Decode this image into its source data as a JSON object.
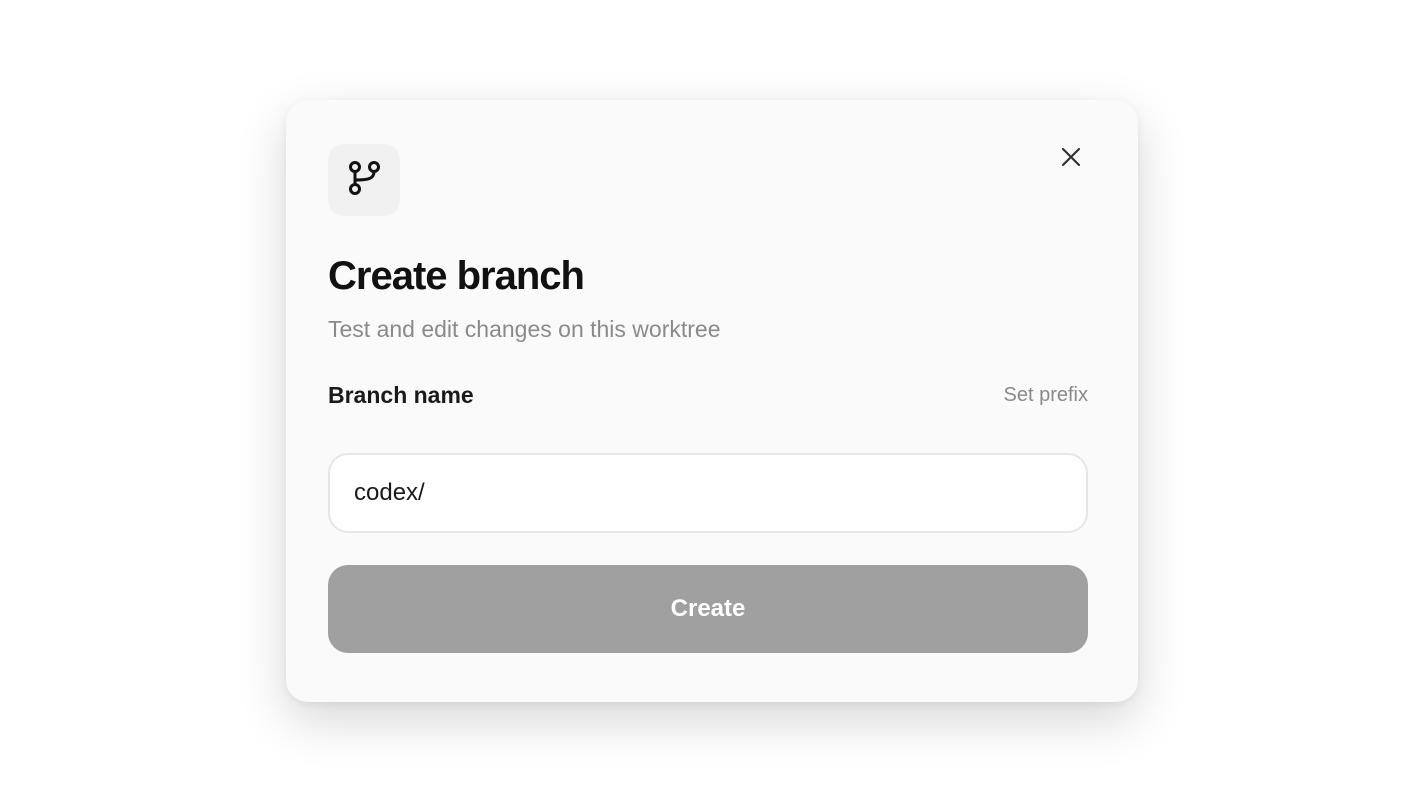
{
  "dialog": {
    "title": "Create branch",
    "subtitle": "Test and edit changes on this worktree",
    "icon": "git-branch-icon",
    "close_icon": "close-icon"
  },
  "form": {
    "label": "Branch name",
    "set_prefix_label": "Set prefix",
    "input_value": "codex/",
    "submit_label": "Create"
  },
  "colors": {
    "dialog_bg": "#fafafa",
    "title": "#111111",
    "muted_text": "#8a8a8a",
    "button_disabled": "#a0a0a0",
    "input_border": "#e6e6e6"
  }
}
